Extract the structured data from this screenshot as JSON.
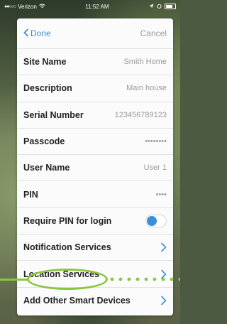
{
  "status": {
    "carrier": "Verizon",
    "time": "11:52 AM"
  },
  "nav": {
    "back_label": "Done",
    "cancel_label": "Cancel"
  },
  "fields": [
    {
      "label": "Site Name",
      "value": "Smith Home"
    },
    {
      "label": "Description",
      "value": "Main house"
    },
    {
      "label": "Serial Number",
      "value": "123456789123"
    },
    {
      "label": "Passcode",
      "value": "••••••••"
    },
    {
      "label": "User Name",
      "value": "User 1"
    },
    {
      "label": "PIN",
      "value": "••••"
    }
  ],
  "toggle": {
    "label": "Require PIN for login",
    "state": "on"
  },
  "links": [
    {
      "label": "Notification Services"
    },
    {
      "label": "Location Services"
    },
    {
      "label": "Add Other Smart Devices"
    }
  ],
  "colors": {
    "accent": "#3a8fd6",
    "highlight": "#8cc63f"
  }
}
